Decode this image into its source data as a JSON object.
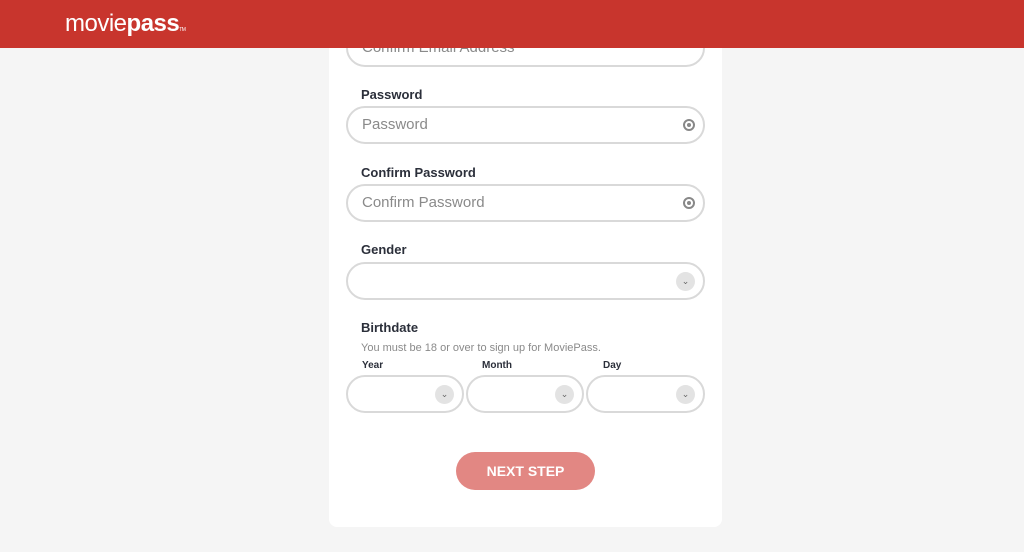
{
  "header": {
    "logo_text": "moviepass",
    "brand_color": "#c8352d"
  },
  "form": {
    "confirm_email": {
      "placeholder": "Confirm Email Address"
    },
    "password": {
      "label": "Password",
      "placeholder": "Password"
    },
    "confirm_password": {
      "label": "Confirm Password",
      "placeholder": "Confirm Password"
    },
    "gender": {
      "label": "Gender",
      "value": ""
    },
    "birthdate": {
      "label": "Birthdate",
      "note": "You must be 18 or over to sign up for MoviePass.",
      "year_label": "Year",
      "month_label": "Month",
      "day_label": "Day"
    },
    "next_label": "NEXT STEP"
  }
}
